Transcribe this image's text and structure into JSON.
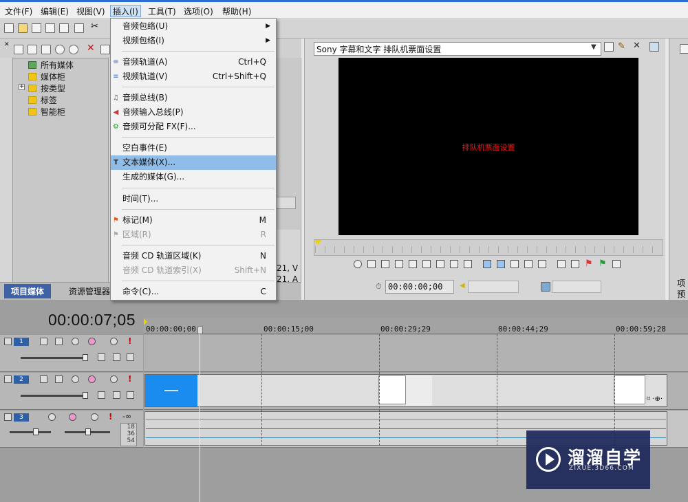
{
  "menubar": {
    "items": [
      "文件(F)",
      "编辑(E)",
      "视图(V)",
      "插入(I)",
      "工具(T)",
      "选项(O)",
      "帮助(H)"
    ]
  },
  "insert_menu": {
    "items": [
      {
        "label": "音频包络(U)",
        "shortcut": "",
        "submenu": true
      },
      {
        "label": "视频包络(I)",
        "shortcut": "",
        "submenu": true
      },
      {
        "label": "音频轨道(A)",
        "shortcut": "Ctrl+Q"
      },
      {
        "label": "视频轨道(V)",
        "shortcut": "Ctrl+Shift+Q"
      },
      {
        "label": "音频总线(B)",
        "shortcut": ""
      },
      {
        "label": "音频输入总线(P)",
        "shortcut": ""
      },
      {
        "label": "音频可分配 FX(F)...",
        "shortcut": ""
      },
      {
        "label": "空白事件(E)",
        "shortcut": ""
      },
      {
        "label": "文本媒体(X)...",
        "shortcut": "",
        "highlighted": true
      },
      {
        "label": "生成的媒体(G)...",
        "shortcut": ""
      },
      {
        "label": "时间(T)...",
        "shortcut": ""
      },
      {
        "label": "标记(M)",
        "shortcut": "M"
      },
      {
        "label": "区域(R)",
        "shortcut": "R",
        "disabled": true
      },
      {
        "label": "音频 CD 轨道区域(K)",
        "shortcut": "N"
      },
      {
        "label": "音频 CD 轨道索引(X)",
        "shortcut": "Shift+N",
        "disabled": true
      },
      {
        "label": "命令(C)...",
        "shortcut": "C"
      }
    ]
  },
  "media_tree": {
    "items": [
      "所有媒体",
      "媒体柜",
      "按类型",
      "标签",
      "智能柜"
    ]
  },
  "media_panel": {
    "partial_text_1": "21, V",
    "partial_text_2": "21, A"
  },
  "bottom_tabs": [
    "项目媒体",
    "资源管理器"
  ],
  "preview": {
    "preset": "Sony 字幕和文字 排队机票面设置",
    "caption": "排队机票面设置",
    "timecode": "00:00:00;00"
  },
  "right_panel": {
    "label1": "项",
    "label2": "预"
  },
  "timeline": {
    "timecode": "00:00:07;05",
    "ruler_labels": [
      "00:00:00;00",
      "00:00:15;00",
      "00:00:29;29",
      "00:00:44;29",
      "00:00:59;28"
    ],
    "tracks": [
      {
        "number": "1",
        "type": "video"
      },
      {
        "number": "2",
        "type": "video"
      },
      {
        "number": "3",
        "type": "audio",
        "level": "-∞",
        "meter": [
          "18",
          "36",
          "54"
        ]
      }
    ]
  },
  "colors": {
    "menu_highlight": "#8fbde8",
    "caption": "#e81b1b",
    "track_number": "#2f5fa5",
    "clip_blue": "#1a8cf0",
    "audio_line": "#3d8eb0"
  },
  "watermark": {
    "title": "溜溜自学",
    "subtitle": "ZIXUE.3D66.COM"
  }
}
